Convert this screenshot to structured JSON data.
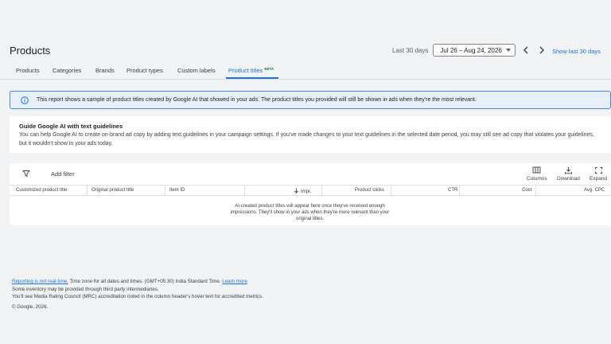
{
  "page": {
    "title": "Products"
  },
  "date": {
    "range_label": "Last 30 days",
    "selected": "Jul 26 – Aug 24, 2026",
    "show_last_label": "Show last 30 days"
  },
  "tabs": [
    {
      "label": "Products"
    },
    {
      "label": "Categories"
    },
    {
      "label": "Brands"
    },
    {
      "label": "Product types"
    },
    {
      "label": "Custom labels"
    },
    {
      "label": "Product titles",
      "badge": "BETA",
      "active": true
    }
  ],
  "banner": {
    "text": "This report shows a sample of product titles created by Google AI that showed in your ads. The product titles you provided will still be shown in ads when they're the most relevant."
  },
  "guide": {
    "title": "Guide Google AI with text guidelines",
    "body": "You can help Google AI to create on-brand ad copy by adding text guidelines in your campaign settings. If you've made changes to your text guidelines in the selected date period, you may still see ad copy that violates your guidelines, but it wouldn't show in your ads today."
  },
  "toolbar": {
    "add_filter": "Add filter",
    "columns": "Columns",
    "download": "Download",
    "expand": "Expand"
  },
  "table": {
    "headers": [
      "Customized product title",
      "Original product title",
      "Item ID",
      "Impr.",
      "Product clicks",
      "CTR",
      "Cost",
      "Avg. CPC"
    ],
    "empty_message": "AI-created product titles will appear here once they've received enough impressions. They'll show in your ads when they're more relevant than your original titles."
  },
  "footer": {
    "not_realtime": "Reporting is not real-time.",
    "timezone": " Time zone for all dates and times: (GMT+05:30) India Standard Time. ",
    "learn_more": "Learn more",
    "inventory": "Some inventory may be provided through third party intermediaries.",
    "mrc": "You'll see Media Rating Council (MRC) accreditation noted in the column header's hover text for accredited metrics.",
    "copyright": "© Google, 2026."
  },
  "colors": {
    "accent": "#1a73e8",
    "banner_bg": "#e8f0fe",
    "beta": "#188038"
  },
  "icons": [
    "info-icon",
    "chevron-left-icon",
    "chevron-right-icon",
    "filter-icon",
    "columns-icon",
    "download-icon",
    "expand-icon",
    "sort-down-icon",
    "caret-down-icon"
  ]
}
